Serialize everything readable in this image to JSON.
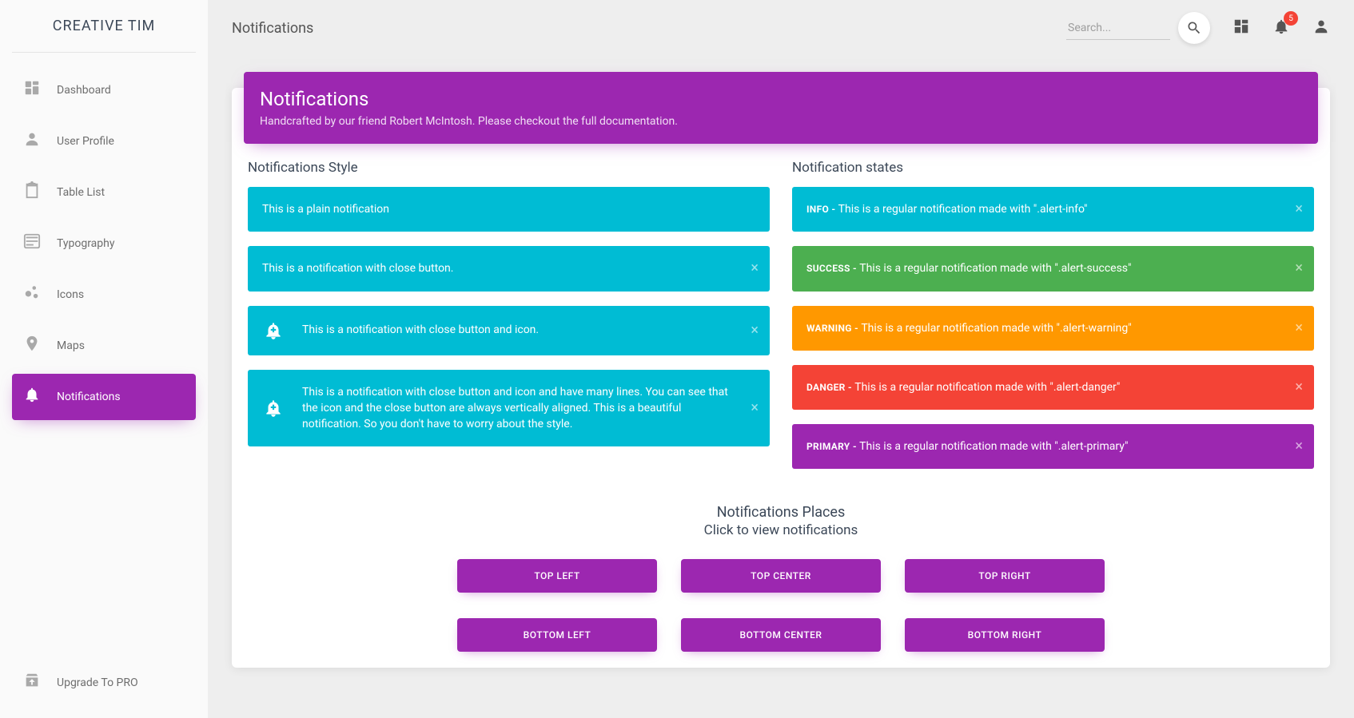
{
  "brand": "CREATIVE TIM",
  "page_title": "Notifications",
  "search": {
    "placeholder": "Search..."
  },
  "notif_badge": "5",
  "sidebar": {
    "items": [
      {
        "label": "Dashboard"
      },
      {
        "label": "User Profile"
      },
      {
        "label": "Table List"
      },
      {
        "label": "Typography"
      },
      {
        "label": "Icons"
      },
      {
        "label": "Maps"
      },
      {
        "label": "Notifications"
      }
    ],
    "upgrade": "Upgrade To PRO"
  },
  "header": {
    "title": "Notifications",
    "sub_pre": "Handcrafted by our friend ",
    "sub_link1": "Robert McIntosh",
    "sub_mid": ". Please checkout the ",
    "sub_link2": "full documentation",
    "sub_end": "."
  },
  "left": {
    "title": "Notifications Style",
    "a1": "This is a plain notification",
    "a2": "This is a notification with close button.",
    "a3": "This is a notification with close button and icon.",
    "a4": "This is a notification with close button and icon and have many lines. You can see that the icon and the close button are always vertically aligned. This is a beautiful notification. So you don't have to worry about the style."
  },
  "right": {
    "title": "Notification states",
    "info": {
      "tag": "INFO - ",
      "msg": "This is a regular notification made with \".alert-info\""
    },
    "success": {
      "tag": "SUCCESS - ",
      "msg": "This is a regular notification made with \".alert-success\""
    },
    "warning": {
      "tag": "WARNING - ",
      "msg": "This is a regular notification made with \".alert-warning\""
    },
    "danger": {
      "tag": "DANGER - ",
      "msg": "This is a regular notification made with \".alert-danger\""
    },
    "primary": {
      "tag": "PRIMARY - ",
      "msg": "This is a regular notification made with \".alert-primary\""
    }
  },
  "places": {
    "title": "Notifications Places",
    "subtitle": "Click to view notifications",
    "buttons": [
      "TOP LEFT",
      "TOP CENTER",
      "TOP RIGHT",
      "BOTTOM LEFT",
      "BOTTOM CENTER",
      "BOTTOM RIGHT"
    ]
  }
}
